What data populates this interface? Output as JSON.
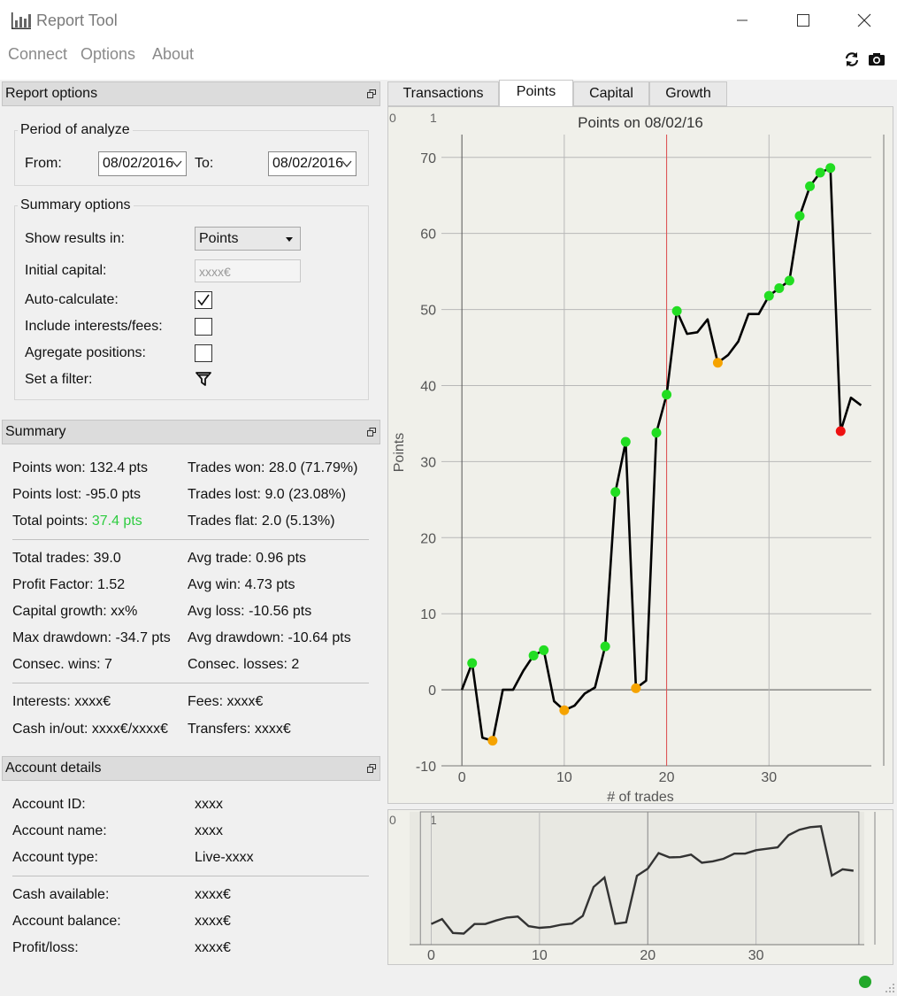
{
  "window": {
    "title": "Report Tool"
  },
  "menu": {
    "connect": "Connect",
    "options": "Options",
    "about": "About"
  },
  "report_options": {
    "header": "Report options",
    "period_title": "Period of analyze",
    "from_label": "From:",
    "from_value": "08/02/2016",
    "to_label": "To:",
    "to_value": "08/02/2016",
    "summary_title": "Summary options",
    "show_results_label": "Show results in:",
    "show_results_value": "Points",
    "initial_capital_label": "Initial capital:",
    "initial_capital_placeholder": "xxxx€",
    "auto_calc_label": "Auto-calculate:",
    "auto_calc_checked": true,
    "interests_label": "Include interests/fees:",
    "interests_checked": false,
    "aggregate_label": "Agregate positions:",
    "aggregate_checked": false,
    "filter_label": "Set a filter:",
    "filter_icon": "funnel-icon"
  },
  "summary": {
    "header": "Summary",
    "points_won": "Points won: 132.4 pts",
    "points_lost": "Points lost: -95.0 pts",
    "total_points_label": "Total points: ",
    "total_points_value": "37.4 pts",
    "total_points_color": "#2ecc40",
    "trades_won": "Trades won: 28.0 (71.79%)",
    "trades_lost": "Trades lost: 9.0 (23.08%)",
    "trades_flat": "Trades flat: 2.0 (5.13%)",
    "total_trades": "Total trades: 39.0",
    "profit_factor": "Profit Factor: 1.52",
    "capital_growth": "Capital growth: xx%",
    "max_drawdown": "Max drawdown: -34.7 pts",
    "consec_wins": "Consec. wins: 7",
    "avg_trade": "Avg trade: 0.96 pts",
    "avg_win": "Avg win: 4.73 pts",
    "avg_loss": "Avg loss: -10.56 pts",
    "avg_drawdown": "Avg drawdown: -10.64 pts",
    "consec_losses": "Consec. losses: 2",
    "interests": "Interests: xxxx€",
    "cash_inout": "Cash in/out: xxxx€/xxxx€",
    "fees": "Fees: xxxx€",
    "transfers": "Transfers: xxxx€"
  },
  "account": {
    "header": "Account details",
    "id_label": "Account ID:",
    "id_value": "xxxx",
    "name_label": "Account name:",
    "name_value": "xxxx",
    "type_label": "Account type:",
    "type_value": "Live-xxxx",
    "cash_label": "Cash available:",
    "cash_value": "xxxx€",
    "balance_label": "Account balance:",
    "balance_value": "xxxx€",
    "pl_label": "Profit/loss:",
    "pl_value": "xxxx€"
  },
  "tabs": [
    "Transactions",
    "Points",
    "Capital",
    "Growth"
  ],
  "active_tab": "Points",
  "chart_data": [
    {
      "type": "line",
      "title": "Points on 08/02/16",
      "xlabel": "# of trades",
      "ylabel": "Points",
      "xlim": [
        -2,
        40
      ],
      "ylim": [
        -10,
        73
      ],
      "xticks": [
        0,
        10,
        20,
        30
      ],
      "yticks": [
        -10,
        0,
        10,
        20,
        30,
        40,
        50,
        60,
        70
      ],
      "grid": true,
      "corner_labels": [
        "0",
        "1"
      ],
      "marker_line_x": 20,
      "marker_line_color": "#e05050",
      "x": [
        0,
        1,
        2,
        3,
        4,
        5,
        6,
        7,
        8,
        9,
        10,
        11,
        12,
        13,
        14,
        15,
        16,
        17,
        18,
        19,
        20,
        21,
        22,
        23,
        24,
        25,
        26,
        27,
        28,
        29,
        30,
        31,
        32,
        33,
        34,
        35,
        36,
        37,
        38,
        39
      ],
      "y": [
        0,
        3.5,
        -6.3,
        -6.7,
        0,
        0,
        2.5,
        4.5,
        5.2,
        -1.5,
        -2.7,
        -2.1,
        -0.5,
        0.3,
        5.7,
        26,
        32.6,
        0.2,
        1.2,
        33.8,
        38.8,
        49.8,
        46.8,
        47,
        48.7,
        43,
        44,
        45.8,
        49.4,
        49.4,
        51.8,
        52.8,
        53.8,
        62.3,
        66.2,
        68,
        68.6,
        34,
        38.4,
        37.4
      ],
      "markers": [
        {
          "x": 1,
          "y": 3.5,
          "color": "green"
        },
        {
          "x": 3,
          "y": -6.7,
          "color": "orange"
        },
        {
          "x": 7,
          "y": 4.5,
          "color": "green"
        },
        {
          "x": 8,
          "y": 5.2,
          "color": "green"
        },
        {
          "x": 10,
          "y": -2.7,
          "color": "orange"
        },
        {
          "x": 14,
          "y": 5.7,
          "color": "green"
        },
        {
          "x": 15,
          "y": 26,
          "color": "green"
        },
        {
          "x": 16,
          "y": 32.6,
          "color": "green"
        },
        {
          "x": 17,
          "y": 0.2,
          "color": "orange"
        },
        {
          "x": 19,
          "y": 33.8,
          "color": "green"
        },
        {
          "x": 20,
          "y": 38.8,
          "color": "green"
        },
        {
          "x": 21,
          "y": 49.8,
          "color": "green"
        },
        {
          "x": 25,
          "y": 43,
          "color": "orange"
        },
        {
          "x": 30,
          "y": 51.8,
          "color": "green"
        },
        {
          "x": 31,
          "y": 52.8,
          "color": "green"
        },
        {
          "x": 32,
          "y": 53.8,
          "color": "green"
        },
        {
          "x": 33,
          "y": 62.3,
          "color": "green"
        },
        {
          "x": 34,
          "y": 66.2,
          "color": "green"
        },
        {
          "x": 35,
          "y": 68,
          "color": "green"
        },
        {
          "x": 36,
          "y": 68.6,
          "color": "green"
        },
        {
          "x": 37,
          "y": 34,
          "color": "red"
        }
      ],
      "colors": {
        "green": "#22dd22",
        "orange": "#f5a300",
        "red": "#ee1111",
        "line": "#000000"
      }
    },
    {
      "type": "line",
      "xlim": [
        -2,
        40
      ],
      "ylim": [
        -12,
        75
      ],
      "xticks": [
        0,
        10,
        20,
        30
      ],
      "corner_labels": [
        "0",
        "1"
      ],
      "line_color": "#333333"
    }
  ]
}
